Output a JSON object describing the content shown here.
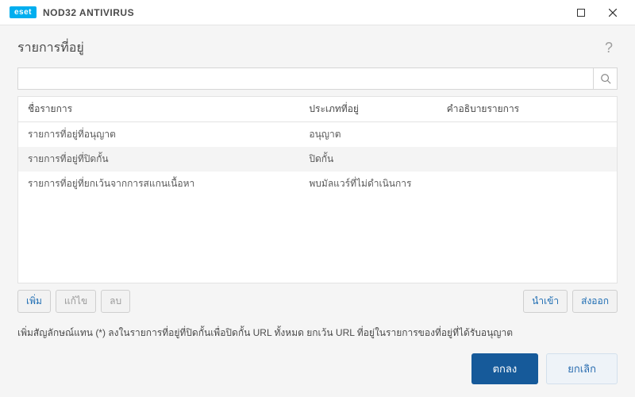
{
  "titlebar": {
    "logo": "eset",
    "product": "NOD32 ANTIVIRUS"
  },
  "heading": "รายการที่อยู่",
  "help_tooltip": "?",
  "table": {
    "headers": {
      "name": "ชื่อรายการ",
      "type": "ประเภทที่อยู่",
      "desc": "คำอธิบายรายการ"
    },
    "rows": [
      {
        "name": "รายการที่อยู่ที่อนุญาต",
        "type": "อนุญาต",
        "desc": ""
      },
      {
        "name": "รายการที่อยู่ที่ปิดกั้น",
        "type": "ปิดกั้น",
        "desc": ""
      },
      {
        "name": "รายการที่อยู่ที่ยกเว้นจากการสแกนเนื้อหา",
        "type": "พบมัลแวร์ที่ไม่ดำเนินการ",
        "desc": ""
      }
    ]
  },
  "actions": {
    "add": "เพิ่ม",
    "edit": "แก้ไข",
    "delete": "ลบ",
    "import": "นำเข้า",
    "export": "ส่งออก"
  },
  "hint": "เพิ่มสัญลักษณ์แทน (*) ลงในรายการที่อยู่ที่ปิดกั้นเพื่อปิดกั้น URL ทั้งหมด ยกเว้น URL ที่อยู่ในรายการของที่อยู่ที่ได้รับอนุญาต",
  "footer": {
    "ok": "ตกลง",
    "cancel": "ยกเลิก"
  },
  "search": {
    "placeholder": ""
  }
}
